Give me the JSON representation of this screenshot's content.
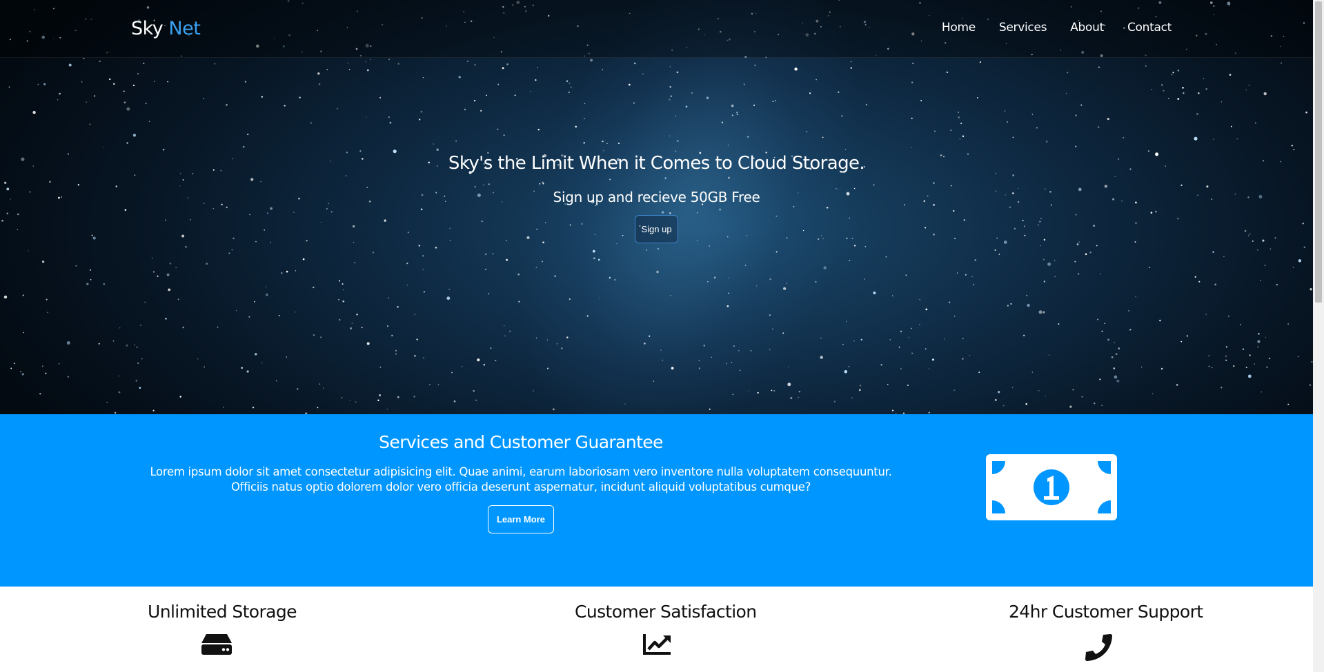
{
  "brand": {
    "name_part1": "Sky",
    "name_part2": "Net"
  },
  "nav": {
    "links": [
      "Home",
      "Services",
      "About",
      "Contact"
    ]
  },
  "hero": {
    "title": "Sky's the Limit When it Comes to Cloud Storage.",
    "subtitle": "Sign up and recieve 50GB Free",
    "cta_label": "Sign up"
  },
  "services": {
    "title": "Services and Customer Guarantee",
    "body": "Lorem ipsum dolor sit amet consectetur adipisicing elit. Quae animi, earum laboriosam vero inventore nulla voluptatem consequuntur. Officiis natus optio dolorem dolor vero officia deserunt aspernatur, incidunt aliquid voluptatibus cumque?",
    "button_label": "Learn More",
    "icon": "money-bill-icon"
  },
  "features": [
    {
      "title": "Unlimited Storage",
      "icon": "hdd-icon"
    },
    {
      "title": "Customer Satisfaction",
      "icon": "chart-line-icon"
    },
    {
      "title": "24hr Customer Support",
      "icon": "phone-icon"
    }
  ],
  "colors": {
    "accent": "#3aa1f0",
    "services_bg": "#0096ff",
    "hero_dark": "#071523"
  }
}
